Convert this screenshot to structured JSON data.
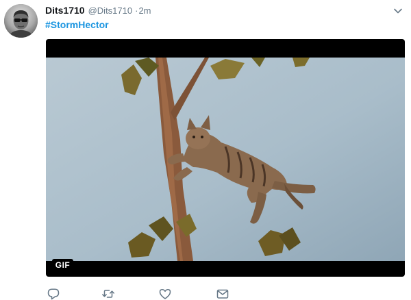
{
  "tweet": {
    "display_name": "Dits1710",
    "handle": "@Dits1710",
    "separator": "·",
    "timestamp": "2m",
    "hashtag": "#StormHector"
  },
  "media": {
    "badge": "GIF"
  },
  "icons": {
    "avatar": "person-sunglasses-avatar",
    "menu": "chevron-down-icon",
    "reply": "reply-bubble-icon",
    "retweet": "retweet-arrows-icon",
    "like": "heart-outline-icon",
    "direct_message": "envelope-icon"
  },
  "colors": {
    "hashtag": "#1b95e0",
    "secondary_text": "#657786",
    "icon_gray": "#657786"
  }
}
